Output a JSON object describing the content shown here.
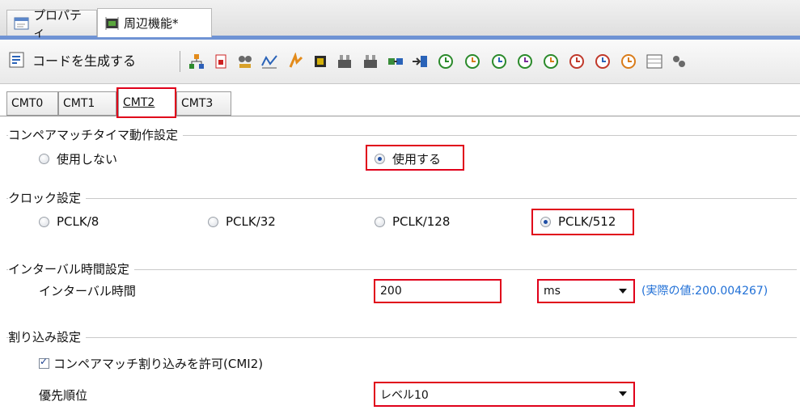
{
  "doc_tabs": [
    {
      "label": "プロパティ",
      "icon": "properties-icon"
    },
    {
      "label": "周辺機能*",
      "icon": "peripheral-icon"
    }
  ],
  "toolbar": {
    "generate_label": "コードを生成する",
    "buttons": [
      "module-icon",
      "clock-icon",
      "port-icon",
      "wave-icon",
      "interrupt-icon",
      "chip-icon",
      "timer-a-icon",
      "timer-b-icon",
      "dma-icon",
      "dtc-icon",
      "cmt-icon",
      "cmt-icon",
      "tpu-icon",
      "tmr-icon",
      "wdt-icon",
      "rtc-icon",
      "alarm-icon",
      "watchdog-icon",
      "table-icon",
      "more-icon"
    ]
  },
  "sub_tabs": [
    "CMT0",
    "CMT1",
    "CMT2",
    "CMT3"
  ],
  "active_sub_tab": "CMT2",
  "compare_match": {
    "title": "コンペアマッチタイマ動作設定",
    "options": [
      "使用しない",
      "使用する"
    ],
    "selected": "使用する"
  },
  "clock": {
    "title": "クロック設定",
    "options": [
      "PCLK/8",
      "PCLK/32",
      "PCLK/128",
      "PCLK/512"
    ],
    "selected": "PCLK/512"
  },
  "interval": {
    "title": "インターバル時間設定",
    "label": "インターバル時間",
    "value": "200",
    "unit": "ms",
    "actual": "(実際の値:200.004267)"
  },
  "interrupt": {
    "title": "割り込み設定",
    "enable_label": "コンペアマッチ割り込みを許可(CMI2)",
    "enabled": true,
    "priority_label": "優先順位",
    "priority_value": "レベル10"
  },
  "colors": {
    "highlight": "#e0001a",
    "accent": "#1f6fd6",
    "tab_line": "#6f93d4"
  }
}
